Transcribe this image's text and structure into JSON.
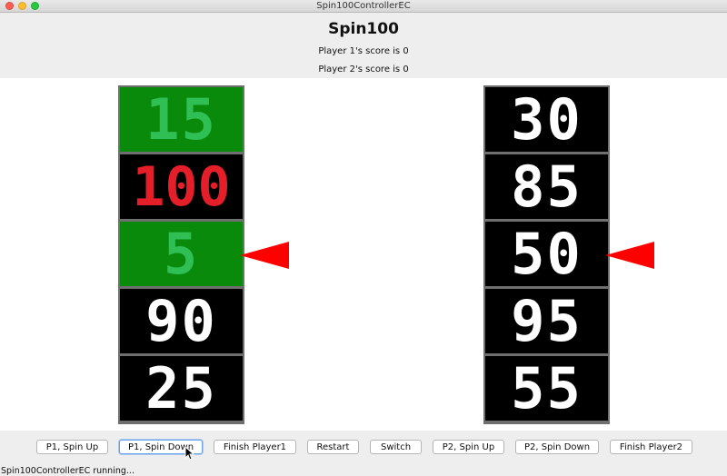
{
  "window": {
    "title": "Spin100ControllerEC"
  },
  "header": {
    "title": "Spin100",
    "player1_score": "Player 1's score is 0",
    "player2_score": "Player 2's score is 0"
  },
  "reels": {
    "player1": [
      {
        "value": "15",
        "style": "green"
      },
      {
        "value": "100",
        "style": "red"
      },
      {
        "value": "5",
        "style": "green"
      },
      {
        "value": "90",
        "style": "normal"
      },
      {
        "value": "25",
        "style": "normal"
      }
    ],
    "player2": [
      {
        "value": "30",
        "style": "normal"
      },
      {
        "value": "85",
        "style": "normal"
      },
      {
        "value": "50",
        "style": "normal"
      },
      {
        "value": "95",
        "style": "normal"
      },
      {
        "value": "55",
        "style": "normal"
      }
    ]
  },
  "controls": {
    "p1_spin_up": "P1, Spin Up",
    "p1_spin_down": "P1, Spin Down",
    "finish_player1": "Finish Player1",
    "restart": "Restart",
    "switch": "Switch",
    "p2_spin_up": "P2, Spin Up",
    "p2_spin_down": "P2, Spin Down",
    "finish_player2": "Finish Player2"
  },
  "status": {
    "text": "Spin100ControllerEC running..."
  },
  "colors": {
    "highlight_green": "#0a8a0a",
    "highlight_digit": "#2fbf55",
    "hundred_red": "#e51f2a",
    "pointer_red": "#ff0000"
  }
}
